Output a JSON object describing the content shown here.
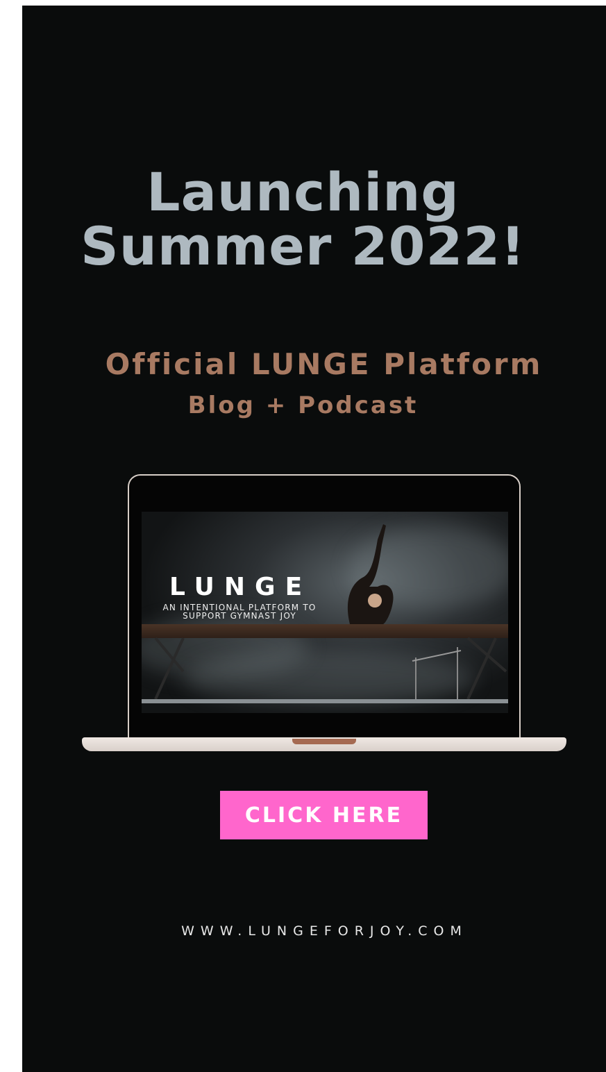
{
  "headline": {
    "line1": "Launching",
    "line2": "Summer 2022!"
  },
  "subtitle": {
    "line1": "Official LUNGE Platform",
    "line2": "Blog + Podcast"
  },
  "laptop_screen": {
    "title": "LUNGE",
    "tagline_line1": "AN INTENTIONAL PLATFORM TO",
    "tagline_line2": "SUPPORT GYMNAST JOY"
  },
  "cta": {
    "label": "CLICK HERE",
    "color": "#ff66cc"
  },
  "footer": {
    "url": "WWW.LUNGEFORJOY.COM"
  },
  "colors": {
    "background": "#0a0c0c",
    "headline": "#aeb9c0",
    "subtitle": "#a87a62"
  }
}
